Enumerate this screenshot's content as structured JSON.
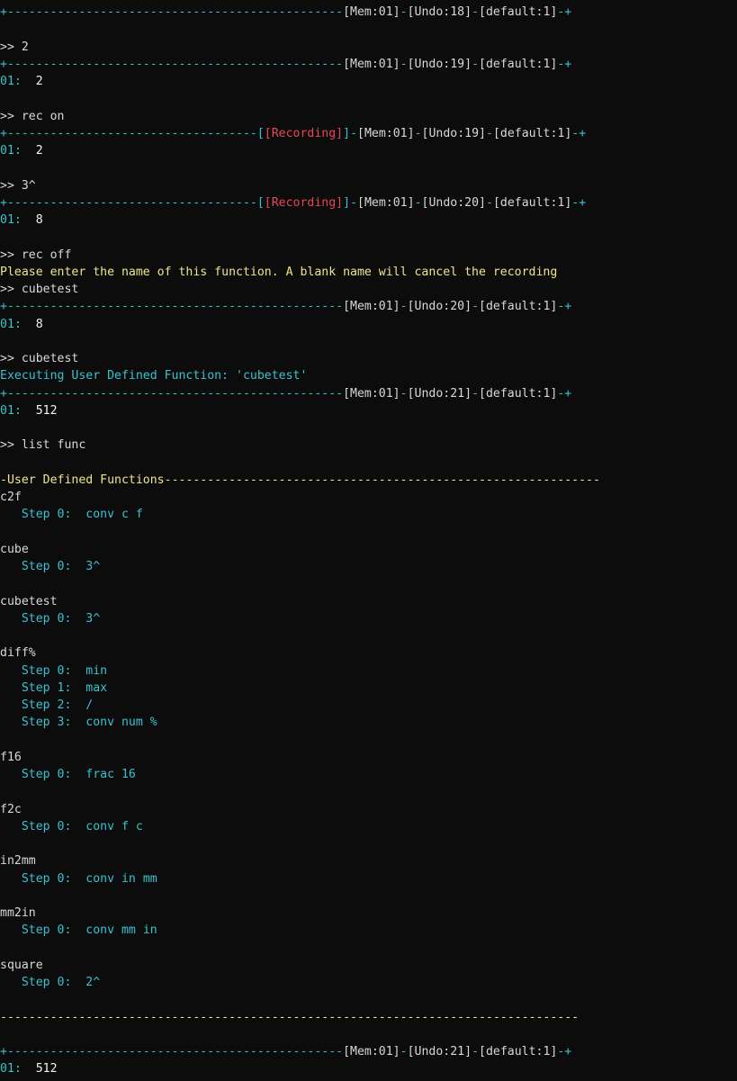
{
  "status_bars": {
    "s1": {
      "mem": "[Mem:01]",
      "undo": "[Undo:18]",
      "stack": "[default:1]"
    },
    "s2": {
      "mem": "[Mem:01]",
      "undo": "[Undo:19]",
      "stack": "[default:1]"
    },
    "s3": {
      "rec": "[Recording]",
      "mem": "[Mem:01]",
      "undo": "[Undo:19]",
      "stack": "[default:1]"
    },
    "s4": {
      "rec": "[Recording]",
      "mem": "[Mem:01]",
      "undo": "[Undo:20]",
      "stack": "[default:1]"
    },
    "s5": {
      "mem": "[Mem:01]",
      "undo": "[Undo:20]",
      "stack": "[default:1]"
    },
    "s6": {
      "mem": "[Mem:01]",
      "undo": "[Undo:21]",
      "stack": "[default:1]"
    },
    "s7": {
      "mem": "[Mem:01]",
      "undo": "[Undo:21]",
      "stack": "[default:1]"
    }
  },
  "commands": {
    "c1": ">> 2",
    "c2": ">> rec on",
    "c3": ">> 3^",
    "c4": ">> rec off",
    "c5": ">> cubetest",
    "c6": ">> cubetest",
    "c7": ">> list func"
  },
  "stack_lines": {
    "l1": {
      "idx": "01:",
      "val": "2"
    },
    "l2": {
      "idx": "01:",
      "val": "2"
    },
    "l3": {
      "idx": "01:",
      "val": "8"
    },
    "l4": {
      "idx": "01:",
      "val": "8"
    },
    "l5": {
      "idx": "01:",
      "val": "512"
    },
    "l6": {
      "idx": "01:",
      "val": "512"
    }
  },
  "messages": {
    "rec_prompt": "Please enter the name of this function. A blank name will cancel the recording",
    "executing": "Executing User Defined Function: 'cubetest'"
  },
  "functions_header": "-User Defined Functions",
  "functions": [
    {
      "name": "c2f",
      "steps": [
        {
          "label": "Step 0:",
          "cmd": "conv c f"
        }
      ]
    },
    {
      "name": "cube",
      "steps": [
        {
          "label": "Step 0:",
          "cmd": "3^"
        }
      ]
    },
    {
      "name": "cubetest",
      "steps": [
        {
          "label": "Step 0:",
          "cmd": "3^"
        }
      ]
    },
    {
      "name": "diff%",
      "steps": [
        {
          "label": "Step 0:",
          "cmd": "min"
        },
        {
          "label": "Step 1:",
          "cmd": "max"
        },
        {
          "label": "Step 2:",
          "cmd": "/"
        },
        {
          "label": "Step 3:",
          "cmd": "conv num %"
        }
      ]
    },
    {
      "name": "f16",
      "steps": [
        {
          "label": "Step 0:",
          "cmd": "frac 16"
        }
      ]
    },
    {
      "name": "f2c",
      "steps": [
        {
          "label": "Step 0:",
          "cmd": "conv f c"
        }
      ]
    },
    {
      "name": "in2mm",
      "steps": [
        {
          "label": "Step 0:",
          "cmd": "conv in mm"
        }
      ]
    },
    {
      "name": "mm2in",
      "steps": [
        {
          "label": "Step 0:",
          "cmd": "conv mm in"
        }
      ]
    },
    {
      "name": "square",
      "steps": [
        {
          "label": "Step 0:",
          "cmd": "2^"
        }
      ]
    }
  ]
}
